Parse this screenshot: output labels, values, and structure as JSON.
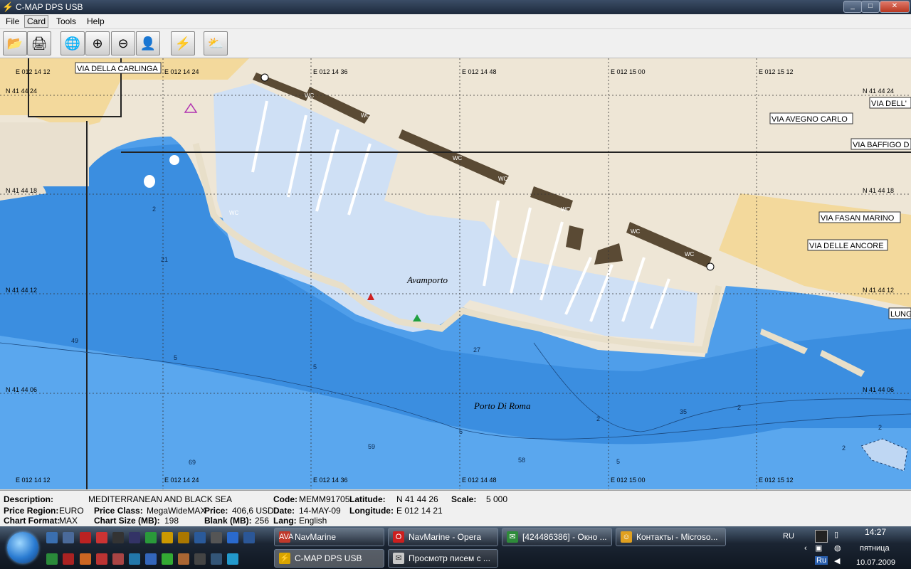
{
  "window": {
    "title": "C-MAP DPS USB",
    "min": "_",
    "max": "□",
    "close": "✕"
  },
  "menu": [
    "File",
    "Card",
    "Tools",
    "Help"
  ],
  "toolbar": [
    {
      "name": "open-folder-icon",
      "glyph": "📂"
    },
    {
      "name": "print-icon",
      "glyph": "🖨"
    },
    {
      "name": "globe-icon",
      "glyph": "🌐"
    },
    {
      "name": "zoom-in-icon",
      "glyph": "⊕"
    },
    {
      "name": "zoom-out-icon",
      "glyph": "⊖"
    },
    {
      "name": "person-icon",
      "glyph": "👤"
    },
    {
      "name": "lightning-icon",
      "glyph": "⚡"
    },
    {
      "name": "weather-icon",
      "glyph": "⛅"
    }
  ],
  "map": {
    "top_coords": [
      "E 012 14 12",
      "E 012 14 24",
      "E 012 14 36",
      "E 012 14 48",
      "E 012 15 00",
      "E 012 15 12"
    ],
    "bottom_coords": [
      "E 012 14 12",
      "E 012 14 24",
      "E 012 14 36",
      "E 012 14 48",
      "E 012 15 00",
      "E 012 15 12"
    ],
    "left_lats": [
      "N 41 44 24",
      "N 41 44 18",
      "N 41 44 12",
      "N 41 44 06"
    ],
    "right_lats": [
      "N 41 44 24",
      "N 41 44 18",
      "N 41 44 12",
      "N 41 44 06"
    ],
    "streets": [
      "VIA DELLA CARLINGA",
      "VIA AVEGNO CARLO",
      "VIA DELL'",
      "VIA BAFFIGO D",
      "VIA FASAN MARINO",
      "VIA DELLE ANCORE",
      "LUNG"
    ],
    "place_labels": [
      "Avamporto",
      "Porto Di Roma"
    ],
    "wc_label": "WC",
    "depths": [
      "2",
      "21",
      "2",
      "49",
      "5",
      "5",
      "27",
      "2",
      "5",
      "59",
      "58",
      "69",
      "35",
      "2",
      "2",
      "2",
      "5"
    ]
  },
  "info": {
    "description_label": "Description:",
    "description": "MEDITERRANEAN AND   BLACK SEA",
    "price_region_label": "Price Region:",
    "price_region": "EURO",
    "price_class_label": "Price Class:",
    "price_class": "MegaWideMAX",
    "price_label": "Price:",
    "price": "406,6 USD",
    "chart_format_label": "Chart Format:",
    "chart_format": "MAX",
    "chart_size_label": "Chart Size (MB):",
    "chart_size": "198",
    "blank_label": "Blank (MB):",
    "blank": "256",
    "code_label": "Code:",
    "code": "MEMM91705",
    "date_label": "Date:",
    "date": "14-MAY-09",
    "lang_label": "Lang:",
    "lang": "English",
    "latitude_label": "Latitude:",
    "latitude": "N 41 44 26",
    "longitude_label": "Longitude:",
    "longitude": "E 012 14 21",
    "scale_label": "Scale:",
    "scale": "5 000"
  },
  "taskbar": {
    "tasks": [
      {
        "label": "NavMarine",
        "icon": "AVA",
        "color": "#c0392b"
      },
      {
        "label": "NavMarine - Opera",
        "icon": "O",
        "color": "#cc1f1f"
      },
      {
        "label": "[424486386] - Окно ...",
        "icon": "✉",
        "color": "#2e8b3a"
      },
      {
        "label": "Контакты - Microso...",
        "icon": "☺",
        "color": "#e0a020"
      },
      {
        "label": "C-MAP DPS USB",
        "icon": "⚡",
        "color": "#d9a400"
      },
      {
        "label": "Просмотр писем с ...",
        "icon": "✉",
        "color": "#c8c8c8"
      }
    ],
    "lang": "RU",
    "lang2": "Ru",
    "time": "14:27",
    "day": "пятница",
    "date": "10.07.2009"
  }
}
